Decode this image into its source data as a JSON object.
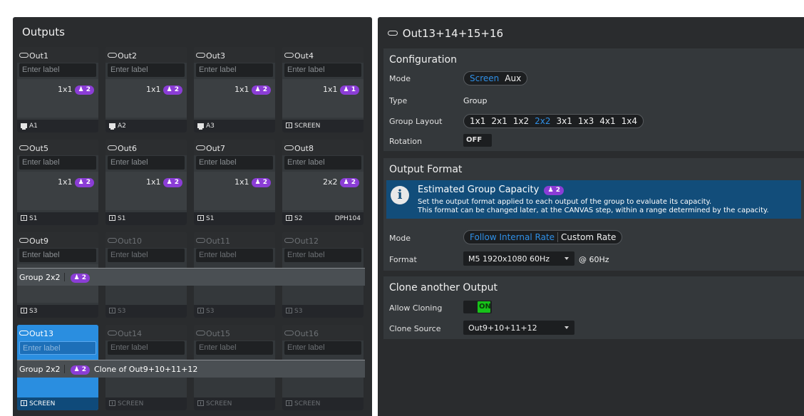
{
  "outputs_panel": {
    "title": "Outputs",
    "label_placeholder": "Enter label",
    "cards": [
      {
        "name": "Out1",
        "res": "1x1",
        "count": "2",
        "source": "A1",
        "source_icon": "monitor-icon",
        "extra": "",
        "dim": false,
        "selected": false
      },
      {
        "name": "Out2",
        "res": "1x1",
        "count": "2",
        "source": "A2",
        "source_icon": "monitor-icon",
        "extra": "",
        "dim": false,
        "selected": false
      },
      {
        "name": "Out3",
        "res": "1x1",
        "count": "2",
        "source": "A3",
        "source_icon": "monitor-icon",
        "extra": "",
        "dim": false,
        "selected": false
      },
      {
        "name": "Out4",
        "res": "1x1",
        "count": "1",
        "source": "SCREEN",
        "source_icon": "screen-icon",
        "extra": "",
        "dim": false,
        "selected": false
      },
      {
        "name": "Out5",
        "res": "1x1",
        "count": "2",
        "source": "S1",
        "source_icon": "screen-icon",
        "extra": "",
        "dim": false,
        "selected": false
      },
      {
        "name": "Out6",
        "res": "1x1",
        "count": "2",
        "source": "S1",
        "source_icon": "screen-icon",
        "extra": "",
        "dim": false,
        "selected": false
      },
      {
        "name": "Out7",
        "res": "1x1",
        "count": "2",
        "source": "S1",
        "source_icon": "screen-icon",
        "extra": "",
        "dim": false,
        "selected": false
      },
      {
        "name": "Out8",
        "res": "2x2",
        "count": "2",
        "source": "S2",
        "source_icon": "screen-icon",
        "extra": "DPH104",
        "dim": false,
        "selected": false
      },
      {
        "name": "Out9",
        "res": "",
        "count": "",
        "source": "S3",
        "source_icon": "screen-icon",
        "extra": "",
        "dim": false,
        "selected": false
      },
      {
        "name": "Out10",
        "res": "",
        "count": "",
        "source": "S3",
        "source_icon": "screen-icon",
        "extra": "",
        "dim": true,
        "selected": false
      },
      {
        "name": "Out11",
        "res": "",
        "count": "",
        "source": "S3",
        "source_icon": "screen-icon",
        "extra": "",
        "dim": true,
        "selected": false
      },
      {
        "name": "Out12",
        "res": "",
        "count": "",
        "source": "S3",
        "source_icon": "screen-icon",
        "extra": "",
        "dim": true,
        "selected": false
      },
      {
        "name": "Out13",
        "res": "",
        "count": "",
        "source": "SCREEN",
        "source_icon": "screen-icon",
        "extra": "",
        "dim": false,
        "selected": true
      },
      {
        "name": "Out14",
        "res": "",
        "count": "",
        "source": "SCREEN",
        "source_icon": "screen-icon",
        "extra": "",
        "dim": true,
        "selected": false
      },
      {
        "name": "Out15",
        "res": "",
        "count": "",
        "source": "SCREEN",
        "source_icon": "screen-icon",
        "extra": "",
        "dim": true,
        "selected": false
      },
      {
        "name": "Out16",
        "res": "",
        "count": "",
        "source": "SCREEN",
        "source_icon": "screen-icon",
        "extra": "",
        "dim": true,
        "selected": false
      }
    ],
    "group_bars": [
      {
        "label": "Group 2x2",
        "count": "2",
        "clone": ""
      },
      {
        "label": "Group 2x2",
        "count": "2",
        "clone": "Clone of Out9+10+11+12"
      }
    ]
  },
  "detail_panel": {
    "title": "Out13+14+15+16",
    "configuration": {
      "title": "Configuration",
      "mode_label": "Mode",
      "mode_options": [
        "Screen",
        "Aux"
      ],
      "mode_selected": "Screen",
      "type_label": "Type",
      "type_value": "Group",
      "layout_label": "Group Layout",
      "layout_options": [
        "1x1",
        "2x1",
        "1x2",
        "2x2",
        "3x1",
        "1x3",
        "4x1",
        "1x4"
      ],
      "layout_selected": "2x2",
      "rotation_label": "Rotation",
      "rotation_value": "OFF"
    },
    "output_format": {
      "title": "Output Format",
      "info_title": "Estimated Group Capacity",
      "info_count": "2",
      "info_line1": "Set the output format applied to each output of the group to evaluate its capacity.",
      "info_line2": "This format can be changed later, at the CANVAS step, within a range determined by the capacity.",
      "mode_label": "Mode",
      "mode_options": [
        "Follow Internal Rate",
        "Custom Rate"
      ],
      "mode_selected": "Follow Internal Rate",
      "format_label": "Format",
      "format_value": "M5 1920x1080 60Hz",
      "format_suffix": "@ 60Hz"
    },
    "clone": {
      "title": "Clone another Output",
      "allow_label": "Allow Cloning",
      "allow_value": "ON",
      "source_label": "Clone Source",
      "source_value": "Out9+10+11+12"
    }
  },
  "colors": {
    "accent": "#2f8fe6",
    "badge": "#8b3dd6",
    "toggle_on": "#17c21a",
    "panel_bg": "#2a2c2e",
    "info_bg": "#124d7a"
  }
}
